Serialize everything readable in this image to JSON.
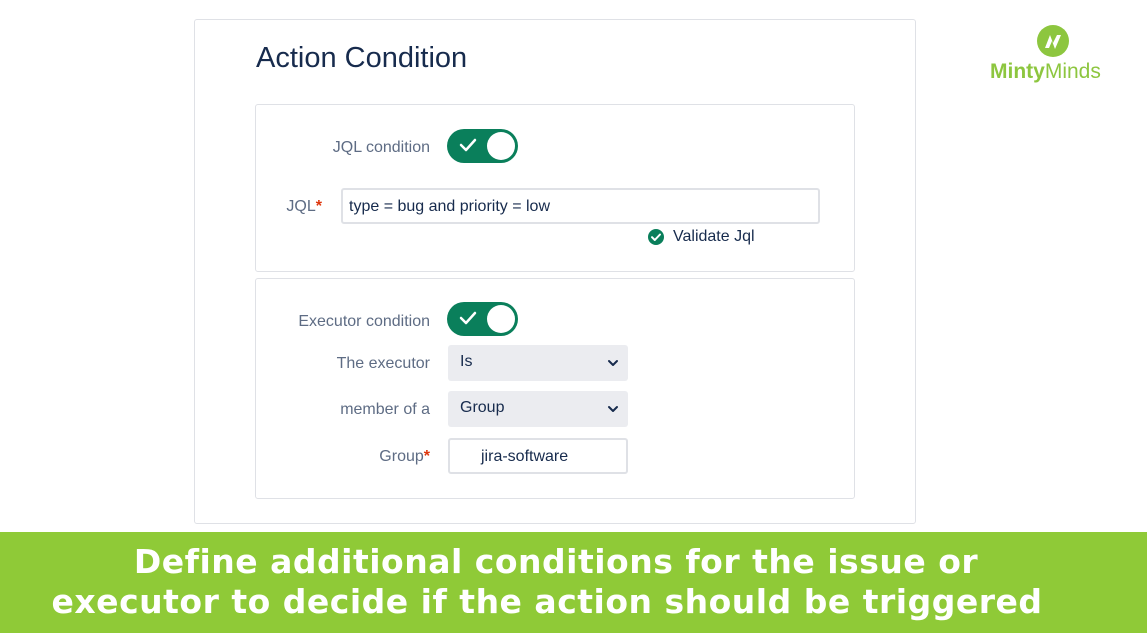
{
  "title": "Action Condition",
  "jql_section": {
    "toggle_label": "JQL condition",
    "toggle_state": true,
    "jql_label": "JQL",
    "required_mark": "*",
    "jql_value": "type = bug and priority = low",
    "validate_label": "Validate Jql"
  },
  "executor_section": {
    "toggle_label": "Executor condition",
    "toggle_state": true,
    "executor_label": "The executor",
    "executor_value": "Is",
    "member_label": "member of a",
    "member_value": "Group",
    "group_label": "Group",
    "required_mark": "*",
    "group_value": "jira-software"
  },
  "logo": {
    "part1": "Minty",
    "part2": "Minds"
  },
  "banner": {
    "line1": "Define additional conditions for the issue or",
    "line2": "executor to decide if the action should be triggered"
  },
  "colors": {
    "toggle_on": "#0a7f5b",
    "banner": "#8fca37",
    "brand": "#8dc63f",
    "required": "#de350b",
    "validate_icon": "#0a7f5b"
  },
  "icons": {
    "toggle_check": "check-icon",
    "validate": "check-circle-icon",
    "select_arrow": "chevron-down-icon",
    "logo_mark": "lightning-icon"
  }
}
